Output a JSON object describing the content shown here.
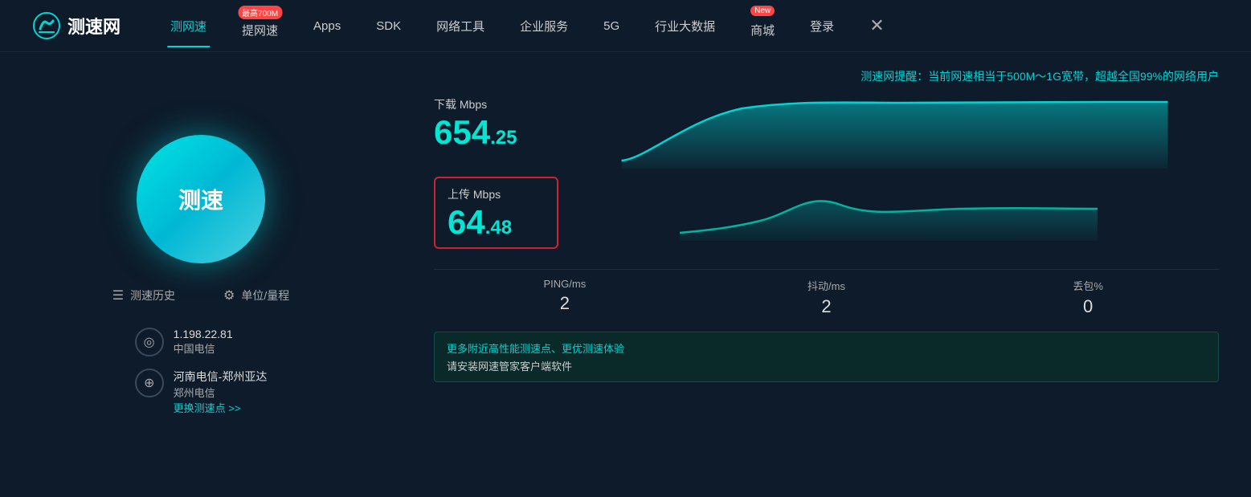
{
  "header": {
    "logo_text": "测速网",
    "nav_items": [
      {
        "id": "test-speed",
        "label": "测网速",
        "active": true,
        "badge": null
      },
      {
        "id": "improve-speed",
        "label": "提网速",
        "active": false,
        "badge": "最高700M"
      },
      {
        "id": "apps",
        "label": "Apps",
        "active": false,
        "badge": null
      },
      {
        "id": "sdk",
        "label": "SDK",
        "active": false,
        "badge": null
      },
      {
        "id": "network-tools",
        "label": "网络工具",
        "active": false,
        "badge": null
      },
      {
        "id": "enterprise",
        "label": "企业服务",
        "active": false,
        "badge": null
      },
      {
        "id": "5g",
        "label": "5G",
        "active": false,
        "badge": null
      },
      {
        "id": "big-data",
        "label": "行业大数据",
        "active": false,
        "badge": null
      },
      {
        "id": "shop",
        "label": "商城",
        "active": false,
        "badge": "New"
      },
      {
        "id": "login",
        "label": "登录",
        "active": false,
        "badge": null
      }
    ],
    "close_label": "✕"
  },
  "main": {
    "alert_text": "测速网提醒：当前网速相当于500M～1G宽带，超越全国",
    "alert_highlight": "99%",
    "alert_suffix": "的网络用户",
    "speed_test_button": "测速",
    "history_label": "测速历史",
    "settings_label": "单位/量程",
    "ip_address": "1.198.22.81",
    "isp_name": "中国电信",
    "location_name": "河南电信-郑州亚达",
    "isp_secondary": "郑州电信",
    "change_node_link": "更换测速点 >>",
    "download": {
      "label": "下载 Mbps",
      "value_main": "654",
      "value_decimal": ".25"
    },
    "upload": {
      "label": "上传 Mbps",
      "value_main": "64",
      "value_decimal": ".48"
    },
    "stats": [
      {
        "label": "PING/ms",
        "value": "2"
      },
      {
        "label": "抖动/ms",
        "value": "2"
      },
      {
        "label": "丢包%",
        "value": "0"
      }
    ],
    "banner": {
      "line1": "更多附近高性能测速点、更优测速体验",
      "line2": "请安装网速管家客户端软件"
    }
  }
}
